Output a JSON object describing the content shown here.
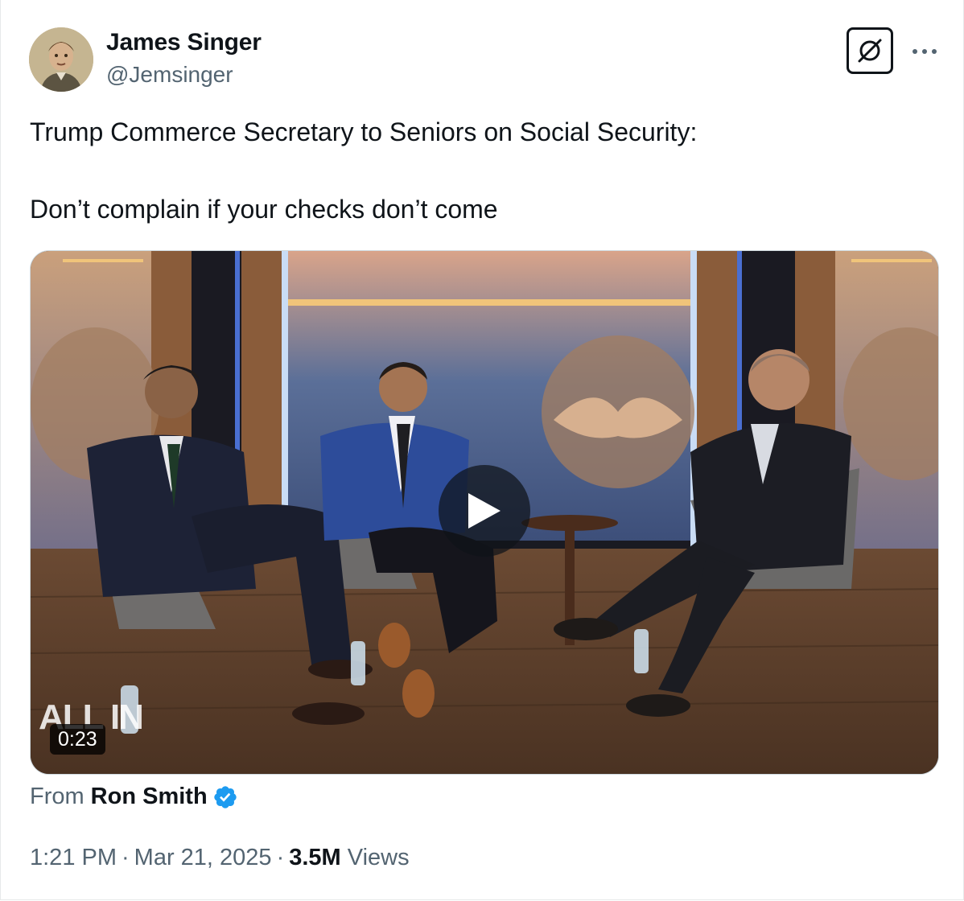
{
  "author": {
    "display_name": "James Singer",
    "handle": "@Jemsinger",
    "avatar_icon": "avatar-photo"
  },
  "actions": {
    "grok_icon": "grok-icon",
    "more_icon": "more-dots-icon"
  },
  "tweet": {
    "line1": "Trump Commerce Secretary to Seniors on Social Security:",
    "line2": "Don’t complain if your checks don’t come"
  },
  "video": {
    "duration": "0:23",
    "watermark": "ALL IN",
    "play_icon": "play-icon"
  },
  "attribution": {
    "from_label": "From",
    "source_name": "Ron Smith",
    "verified_icon": "verified-badge-icon",
    "verified_color": "#1d9bf0"
  },
  "meta": {
    "time": "1:21 PM",
    "separator": "·",
    "date": "Mar 21, 2025",
    "views_count": "3.5M",
    "views_label": "Views"
  },
  "colors": {
    "text_primary": "#0f1419",
    "text_secondary": "#536471",
    "border": "#cfd9de"
  }
}
